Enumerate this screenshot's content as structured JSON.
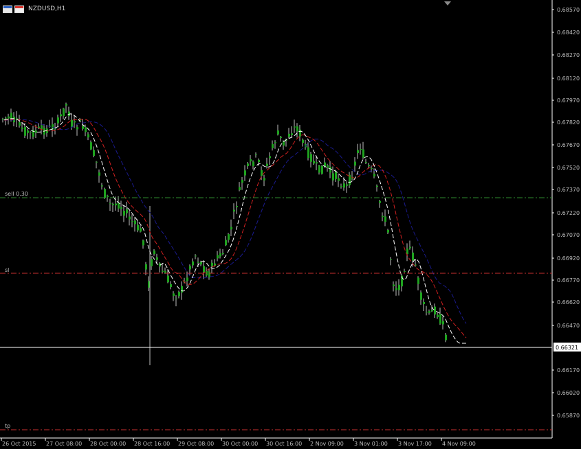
{
  "window": {
    "title": "NZDUSD,H1"
  },
  "price_axis": {
    "labels": [
      "0.68570",
      "0.68420",
      "0.68270",
      "0.68120",
      "0.67970",
      "0.67820",
      "0.67670",
      "0.67520",
      "0.67370",
      "0.67220",
      "0.67070",
      "0.66920",
      "0.66770",
      "0.66620",
      "0.66470",
      "0.66321",
      "0.66170",
      "0.66020",
      "0.65870"
    ],
    "current_price": "0.66321"
  },
  "time_axis": {
    "labels": [
      "26 Oct 2015",
      "27 Oct 08:00",
      "28 Oct 00:00",
      "28 Oct 16:00",
      "29 Oct 08:00",
      "30 Oct 00:00",
      "30 Oct 16:00",
      "2 Nov 09:00",
      "3 Nov 01:00",
      "3 Nov 17:00",
      "4 Nov 09:00"
    ]
  },
  "levels": {
    "sell_label": "sell 0.30",
    "sl_label": "sl",
    "tp_label": "tp"
  },
  "colors": {
    "background": "#000000",
    "grid_text": "#bdbdbd",
    "bull": "#1fa31f",
    "bear": "#1fa31f",
    "wick": "#ffffff",
    "ma_fast": "#ffffff",
    "ma_mid": "#d02020",
    "ma_slow": "#1a1a8c",
    "sell_line": "#2e8b2e",
    "sl_line": "#c83030",
    "tp_line": "#c83030",
    "price_line": "#ffffff"
  },
  "icons": [
    "chart-window-icon",
    "chart-type-icon",
    "scroll-marker-icon"
  ]
}
